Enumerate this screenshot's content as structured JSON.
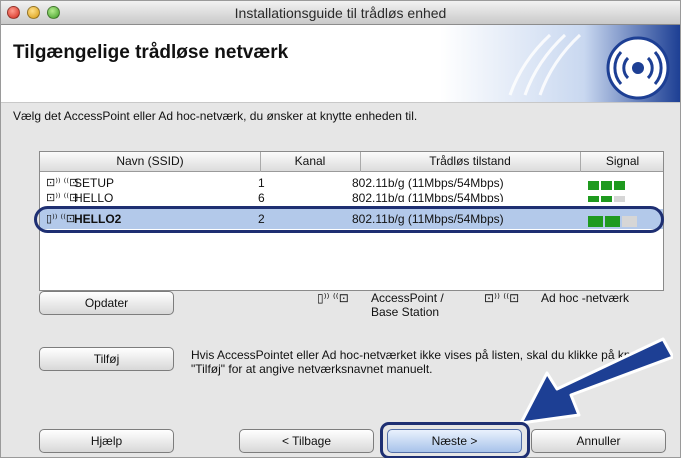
{
  "window": {
    "title": "Installationsguide til trådløs enhed"
  },
  "header": {
    "title": "Tilgængelige trådløse netværk"
  },
  "instruction": "Vælg det AccessPoint eller Ad hoc-netværk, du ønsker at knytte enheden til.",
  "table": {
    "columns": [
      "Navn (SSID)",
      "Kanal",
      "Trådløs tilstand",
      "Signal"
    ],
    "rows": [
      {
        "type_icon": "ad-hoc",
        "icon_text": "⊡⁾⁾ ⁽⁽⊡",
        "name": "SETUP",
        "channel": "1",
        "mode": "802.11b/g (11Mbps/54Mbps)",
        "signal_bars": 3,
        "selected": false
      },
      {
        "type_icon": "ad-hoc",
        "icon_text": "⊡⁾⁾ ⁽⁽⊡",
        "name": "HELLO",
        "channel": "6",
        "mode": "802.11b/g (11Mbps/54Mbps)",
        "signal_bars": 2,
        "selected": false
      },
      {
        "type_icon": "access-point",
        "icon_text": "▯⁾⁾ ⁽⁽⊡",
        "name": "HELLO2",
        "channel": "2",
        "mode": "802.11b/g (11Mbps/54Mbps)",
        "signal_bars": 2,
        "selected": true
      }
    ]
  },
  "buttons": {
    "update": "Opdater",
    "add": "Tilføj",
    "help": "Hjælp",
    "back": "< Tilbage",
    "next": "Næste >",
    "cancel": "Annuller"
  },
  "legend": {
    "access_point": "AccessPoint /\nBase Station",
    "ad_hoc": "Ad hoc -netværk"
  },
  "help_text": "Hvis AccessPointet eller Ad hoc-netværket ikke vises på listen, skal du klikke på knappen \"Tilføj\" for at angive netværksnavnet manuelt.",
  "colors": {
    "selection": "#b3c9ea",
    "highlight_ring": "#1e2f72",
    "signal_on": "#1f9a1f",
    "signal_off": "#d6d6d6",
    "arrow": "#1d3f94"
  }
}
